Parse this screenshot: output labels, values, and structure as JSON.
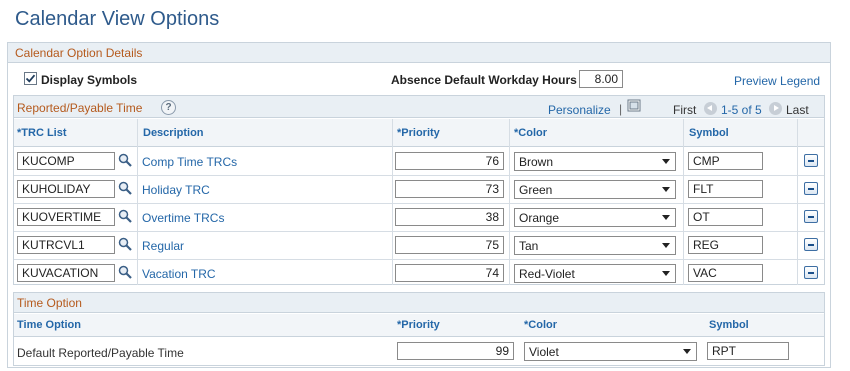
{
  "page": {
    "title": "Calendar View Options"
  },
  "details": {
    "header": "Calendar Option Details",
    "display_symbols_label": "Display Symbols",
    "display_symbols_checked": true,
    "absence_label": "Absence Default Workday Hours",
    "absence_value": "8.00",
    "preview_legend": "Preview Legend"
  },
  "reported": {
    "title": "Reported/Payable Time",
    "help": "?",
    "personalize": "Personalize",
    "separator": "|",
    "nav_first": "First",
    "nav_range": "1-5 of 5",
    "nav_last": "Last",
    "columns": {
      "trc": "*TRC List",
      "description": "Description",
      "priority": "*Priority",
      "color": "*Color",
      "symbol": "Symbol"
    },
    "rows": [
      {
        "trc": "KUCOMP",
        "description": "Comp Time TRCs",
        "priority": "76",
        "color": "Brown",
        "symbol": "CMP"
      },
      {
        "trc": "KUHOLIDAY",
        "description": "Holiday TRC",
        "priority": "73",
        "color": "Green",
        "symbol": "FLT"
      },
      {
        "trc": "KUOVERTIME",
        "description": "Overtime TRCs",
        "priority": "38",
        "color": "Orange",
        "symbol": "OT"
      },
      {
        "trc": "KUTRCVL1",
        "description": "Regular",
        "priority": "75",
        "color": "Tan",
        "symbol": "REG"
      },
      {
        "trc": "KUVACATION",
        "description": "Vacation TRC",
        "priority": "74",
        "color": "Red-Violet",
        "symbol": "VAC"
      }
    ]
  },
  "time_option": {
    "title": "Time Option",
    "columns": {
      "option": "Time Option",
      "priority": "*Priority",
      "color": "*Color",
      "symbol": "Symbol"
    },
    "row": {
      "option": "Default Reported/Payable Time",
      "priority": "99",
      "color": "Violet",
      "symbol": "RPT"
    }
  },
  "icons": {
    "checkbox": "checkmark-icon",
    "lookup": "magnifier-icon",
    "delete": "minus-icon",
    "help": "help-icon",
    "personalize": "personalize-icon",
    "prev": "previous-arrow-icon",
    "next": "next-arrow-icon"
  },
  "colors": {
    "title": "#2e5a8b",
    "section_header": "#b55a1d",
    "link": "#2467a8",
    "header_bg": "#e9eff4"
  }
}
